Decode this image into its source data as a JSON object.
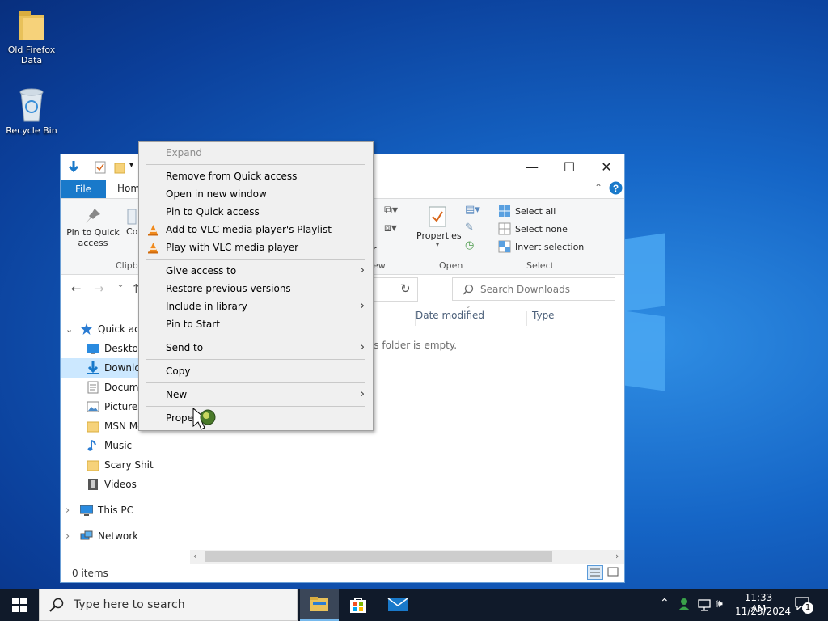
{
  "desktop": {
    "icons": [
      {
        "label": "Old Firefox Data",
        "icon": "folder-icon"
      },
      {
        "label": "Recycle Bin",
        "icon": "recycle-bin-icon"
      }
    ]
  },
  "explorer": {
    "qat": {
      "icons": [
        "properties-icon",
        "new-folder-icon",
        "qat-dropdown-icon"
      ]
    },
    "title_controls": {
      "minimize": "—",
      "maximize": "☐",
      "close": "✕"
    },
    "tabs": {
      "file": "File",
      "home": "Home"
    },
    "ribbon": {
      "pin_quick_access": "Pin to Quick access",
      "copy_partial": "Co",
      "clipboard_label": "Clipb",
      "view_label": "ew",
      "new_partial": "r",
      "properties": "Properties",
      "open_label": "Open",
      "select_all": "Select all",
      "select_none": "Select none",
      "invert_selection": "Invert selection",
      "select_label": "Select"
    },
    "nav": {
      "back": "←",
      "forward": "→",
      "recent": "⌄",
      "up": "↑",
      "refresh": "↻"
    },
    "search_placeholder": "Search Downloads",
    "columns": {
      "date_modified": "Date modified",
      "type": "Type"
    },
    "empty_text": "is folder is empty.",
    "tree": [
      {
        "label": "Quick acce",
        "icon": "star-icon",
        "indent": 1,
        "chevron": "⌄"
      },
      {
        "label": "Desktop",
        "icon": "desktop-icon",
        "indent": 2
      },
      {
        "label": "Downlo",
        "icon": "download-icon",
        "indent": 2,
        "selected": true
      },
      {
        "label": "Docume",
        "icon": "documents-icon",
        "indent": 2
      },
      {
        "label": "Pictures",
        "icon": "pictures-icon",
        "indent": 2
      },
      {
        "label": "MSN Me",
        "icon": "folder-icon",
        "indent": 2
      },
      {
        "label": "Music",
        "icon": "music-icon",
        "indent": 2
      },
      {
        "label": "Scary Shit",
        "icon": "folder-icon",
        "indent": 2
      },
      {
        "label": "Videos",
        "icon": "videos-icon",
        "indent": 2
      },
      {
        "label": "This PC",
        "icon": "this-pc-icon",
        "indent": 1,
        "chevron": "›"
      },
      {
        "label": "Network",
        "icon": "network-icon",
        "indent": 1,
        "chevron": "›"
      }
    ],
    "status": "0 items"
  },
  "context_menu": {
    "items": [
      {
        "label": "Expand",
        "disabled": true
      },
      {
        "label": "Remove from Quick access"
      },
      {
        "label": "Open in new window"
      },
      {
        "label": "Pin to Quick access"
      },
      {
        "label": "Add to VLC media player's Playlist",
        "icon": "vlc-icon"
      },
      {
        "label": "Play with VLC media player",
        "icon": "vlc-icon"
      },
      {
        "label": "Give access to",
        "submenu": true
      },
      {
        "label": "Restore previous versions"
      },
      {
        "label": "Include in library",
        "submenu": true
      },
      {
        "label": "Pin to Start"
      },
      {
        "label": "Send to",
        "submenu": true
      },
      {
        "label": "Copy"
      },
      {
        "label": "New",
        "submenu": true
      },
      {
        "label": "Proper"
      }
    ],
    "cursor": "busy-cursor-icon"
  },
  "taskbar": {
    "search_placeholder": "Type here to search",
    "apps": [
      "file-explorer-icon",
      "store-icon",
      "mail-icon"
    ],
    "time": "11:33 AM",
    "date": "11/23/2024",
    "notification_count": "1"
  },
  "colors": {
    "accent": "#1979ca",
    "desktop": "#1565c6",
    "taskbar": "#101a2a",
    "selection": "#cce8ff"
  }
}
